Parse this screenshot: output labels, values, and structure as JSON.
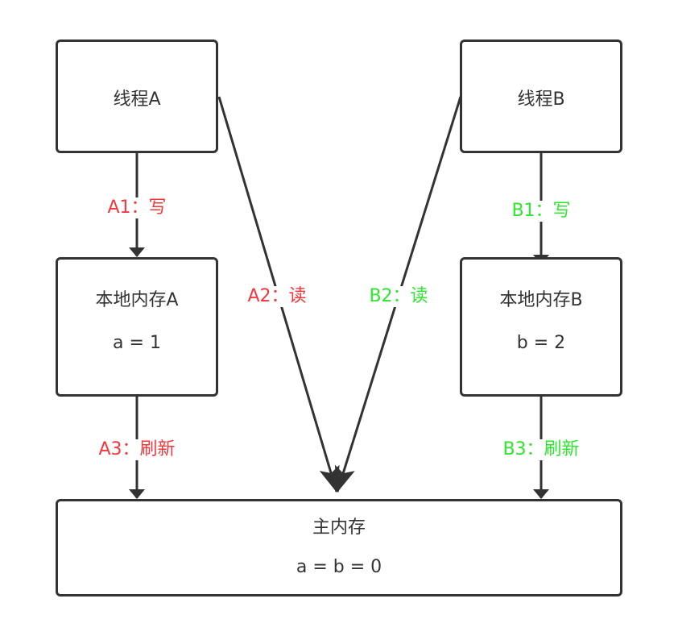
{
  "nodes": {
    "thread_a": {
      "title": "线程A"
    },
    "thread_b": {
      "title": "线程B"
    },
    "local_a": {
      "title": "本地内存A",
      "value": "a = 1"
    },
    "local_b": {
      "title": "本地内存B",
      "value": "b = 2"
    },
    "main": {
      "title": "主内存",
      "value": "a = b = 0"
    }
  },
  "edges": {
    "a1": {
      "label": "A1：写"
    },
    "a2": {
      "label": "A2：读"
    },
    "a3": {
      "label": "A3：刷新"
    },
    "b1": {
      "label": "B1：写"
    },
    "b2": {
      "label": "B2：读"
    },
    "b3": {
      "label": "B3：刷新"
    }
  },
  "colors": {
    "stroke": "#333333",
    "thread_a_label": "#f5363a",
    "thread_b_label": "#2ce82c"
  }
}
